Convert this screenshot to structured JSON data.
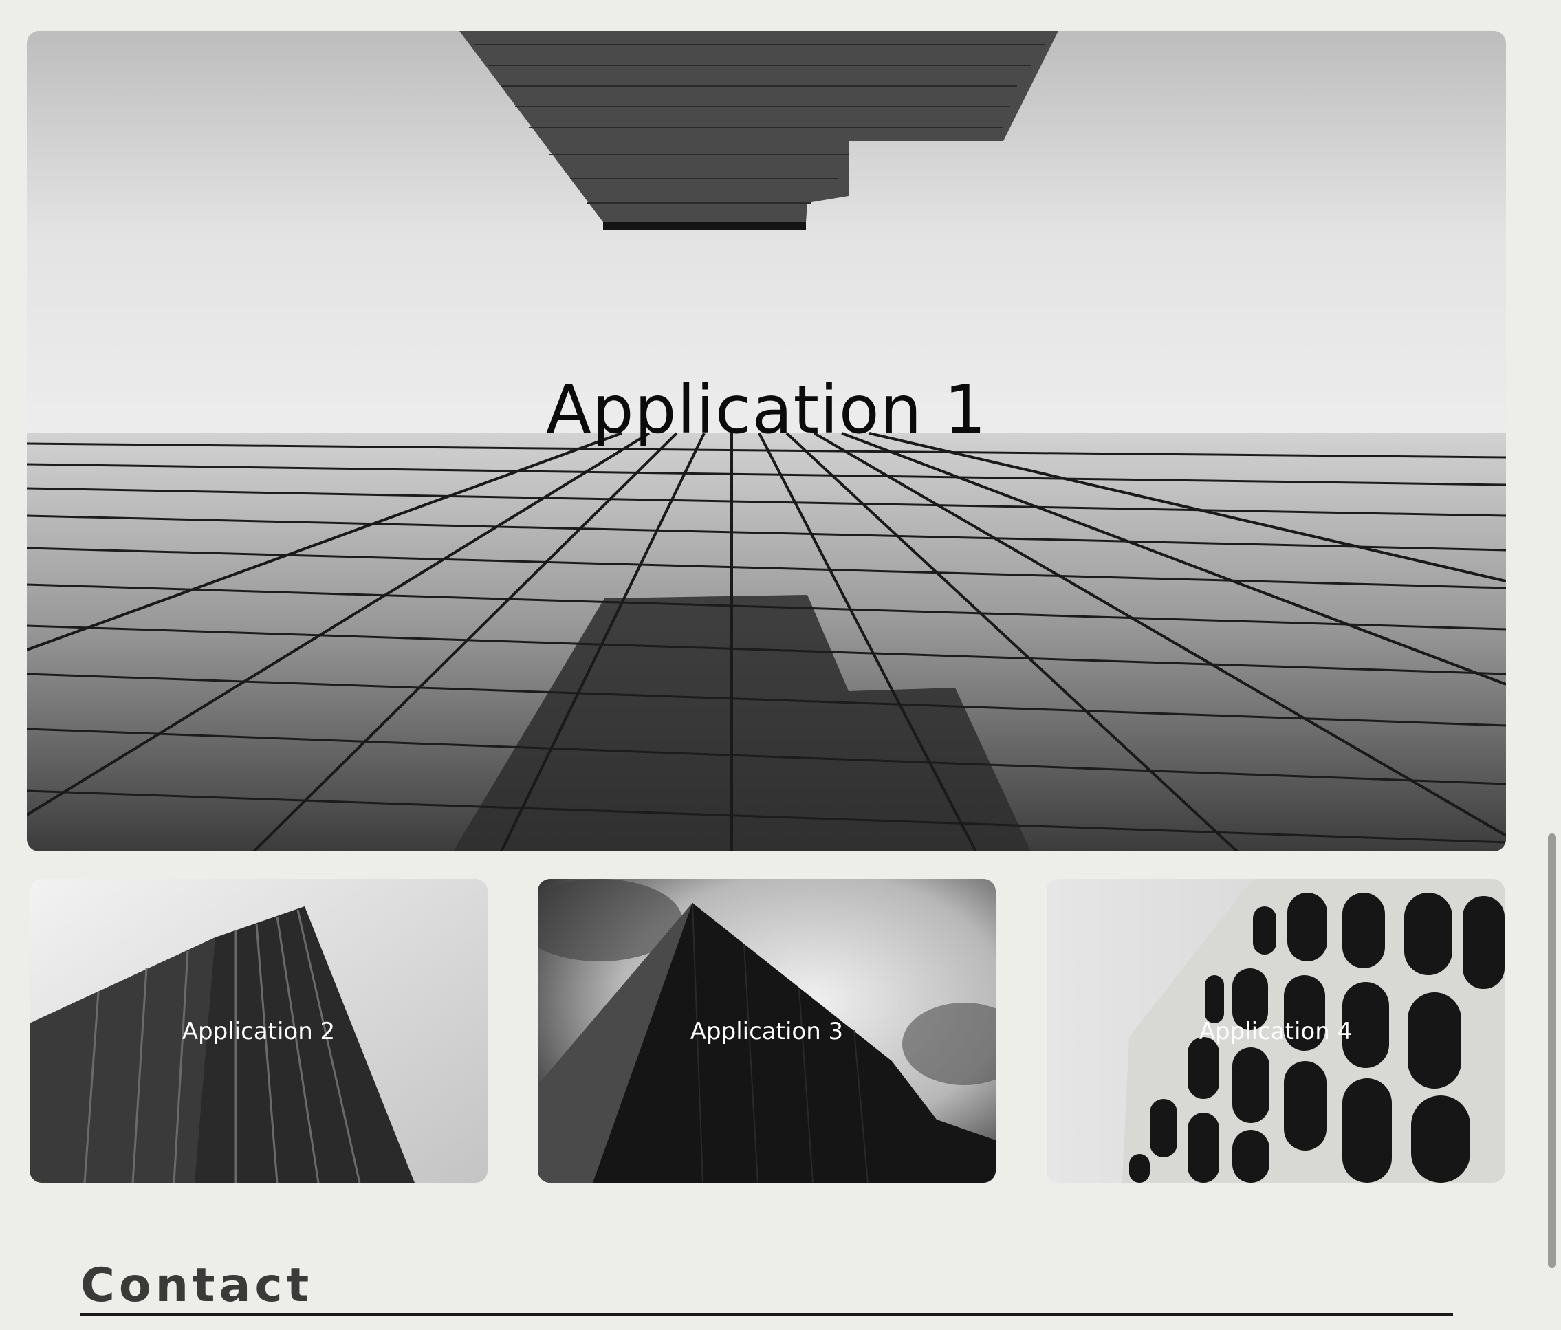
{
  "applications": {
    "featured": {
      "title": "Application 1"
    },
    "items": [
      {
        "title": "Application 2"
      },
      {
        "title": "Application 3"
      },
      {
        "title": "Application 4"
      }
    ]
  },
  "contact": {
    "heading": "Contact"
  },
  "colors": {
    "page_background": "#ededea",
    "heading_text": "#3a3a38"
  }
}
